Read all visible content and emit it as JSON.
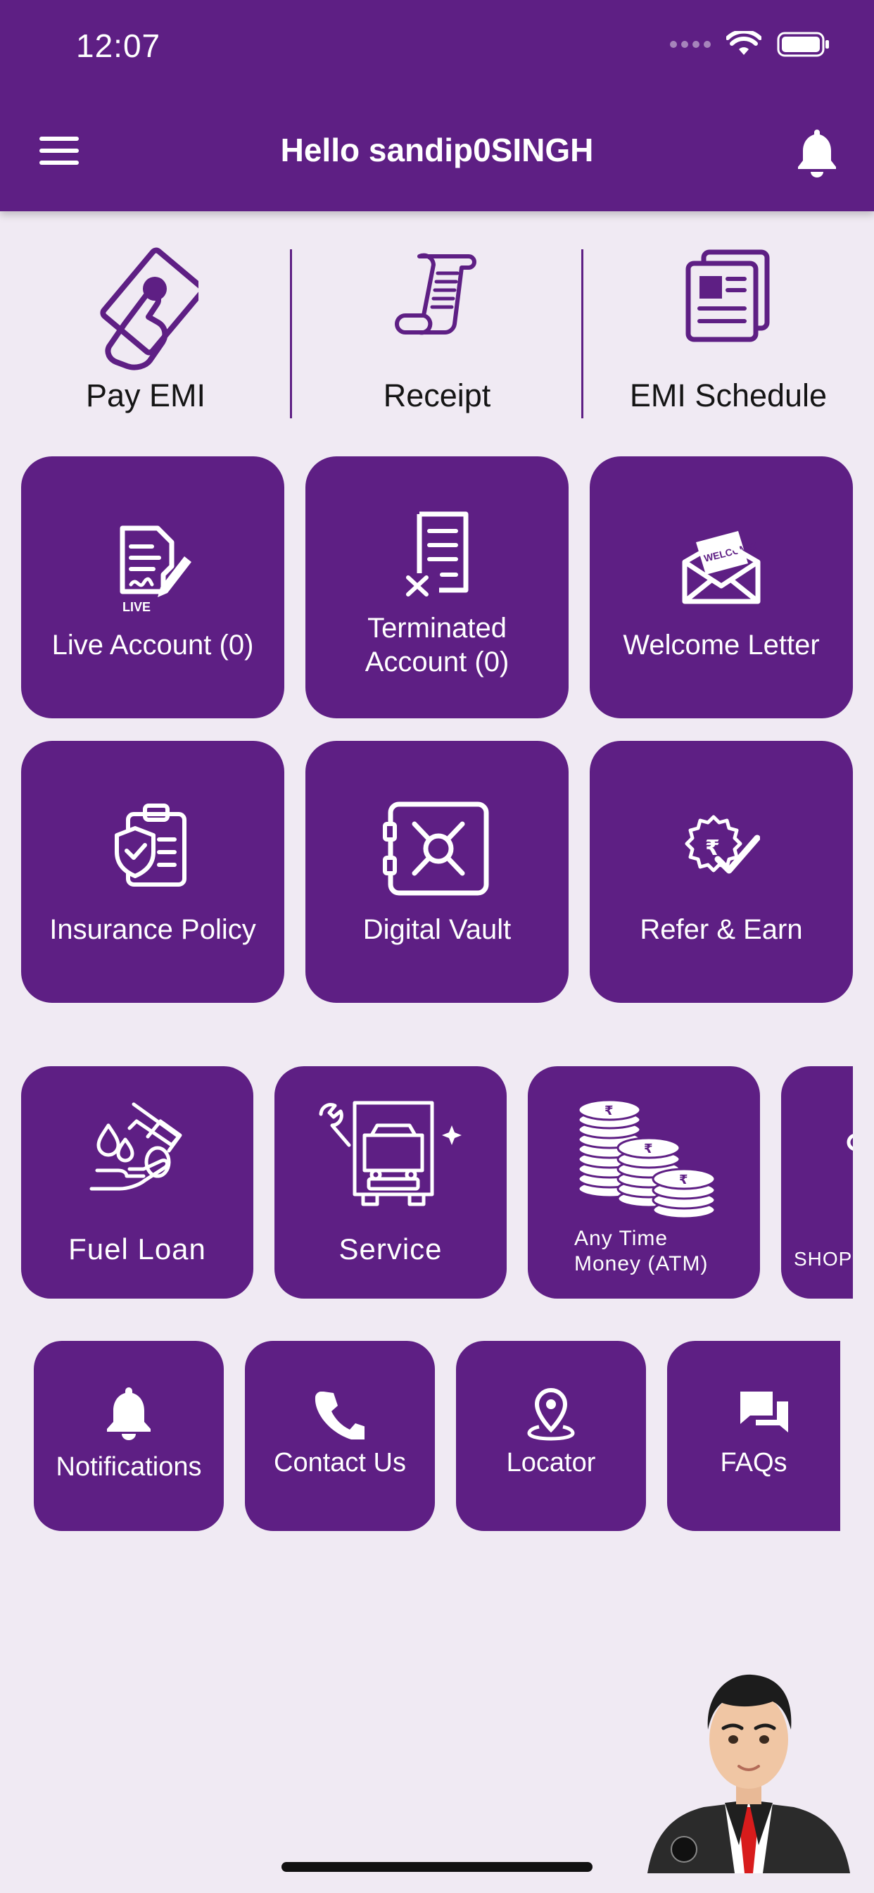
{
  "status_bar": {
    "time": "12:07"
  },
  "header": {
    "title": "Hello sandip0SINGH"
  },
  "quick_actions": [
    {
      "label": "Pay EMI",
      "icon": "hand-money-icon"
    },
    {
      "label": "Receipt",
      "icon": "receipt-scroll-icon"
    },
    {
      "label": "EMI Schedule",
      "icon": "document-stack-icon"
    }
  ],
  "tiles": [
    {
      "label": "Live Account (0)",
      "icon": "live-contract-icon",
      "icon_text": "LIVE"
    },
    {
      "label_line1": "Terminated",
      "label_line2": "Account (0)",
      "icon": "terminated-document-icon"
    },
    {
      "label": "Welcome Letter",
      "icon": "welcome-envelope-icon",
      "icon_text": "WELCOME!"
    },
    {
      "label": "Insurance Policy",
      "icon": "insurance-clipboard-icon"
    },
    {
      "label": "Digital Vault",
      "icon": "vault-safe-icon"
    },
    {
      "label": "Refer & Earn",
      "icon": "rupee-badge-check-icon"
    }
  ],
  "services": [
    {
      "label": "Fuel Loan",
      "icon": "fuel-hand-icon"
    },
    {
      "label": "Service",
      "icon": "truck-wrench-icon"
    },
    {
      "label_line1": "Any Time",
      "label_line2": "Money (ATM)",
      "icon": "rupee-coins-icon"
    },
    {
      "label": "SHOP",
      "icon": "shop-icon"
    }
  ],
  "shortcuts": [
    {
      "label": "Notifications",
      "icon": "bell-icon"
    },
    {
      "label": "Contact Us",
      "icon": "phone-icon"
    },
    {
      "label": "Locator",
      "icon": "location-pin-icon"
    },
    {
      "label": "FAQs",
      "icon": "chat-bubbles-icon"
    }
  ],
  "colors": {
    "primary": "#5e1f84",
    "background": "#f0eaf3",
    "on_primary": "#ffffff"
  }
}
